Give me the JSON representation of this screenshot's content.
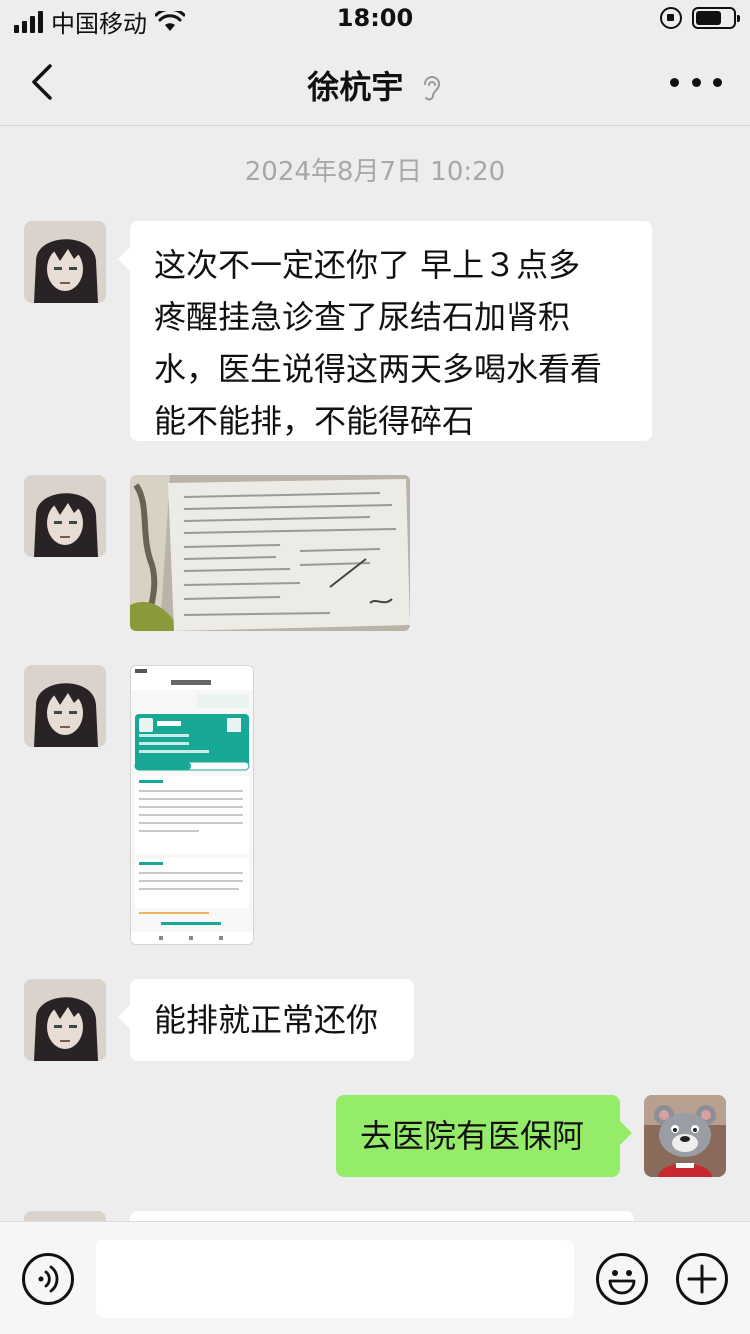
{
  "status_bar": {
    "carrier": "中国移动",
    "time": "18:00"
  },
  "nav": {
    "title": "徐杭宇",
    "back_icon": "chevron-left-icon",
    "more_icon": "more-dots-icon",
    "ear_icon": "earpiece-icon"
  },
  "chat": {
    "timestamp": "2024年8月7日 10:20",
    "messages": [
      {
        "sender": "contact",
        "type": "text",
        "lines": [
          "这次不一定还你了  早上３点多",
          "疼醒挂急诊查了尿结石加肾积",
          "水，医生说得这两天多喝水看看",
          "能不能排，不能得碎石"
        ]
      },
      {
        "sender": "contact",
        "type": "image",
        "image": "photo-of-medical-report"
      },
      {
        "sender": "contact",
        "type": "image",
        "image": "screenshot-of-patient-record"
      },
      {
        "sender": "contact",
        "type": "text",
        "text": "能排就正常还你"
      },
      {
        "sender": "me",
        "type": "text",
        "text": "去医院有医保阿"
      }
    ]
  },
  "input_bar": {
    "placeholder": "",
    "voice_icon": "voice-icon",
    "emoji_icon": "emoji-icon",
    "plus_icon": "plus-icon"
  },
  "colors": {
    "chat_bg": "#ededed",
    "incoming_bubble": "#ffffff",
    "outgoing_bubble": "#95ec69",
    "timestamp": "#a8a8a8"
  }
}
